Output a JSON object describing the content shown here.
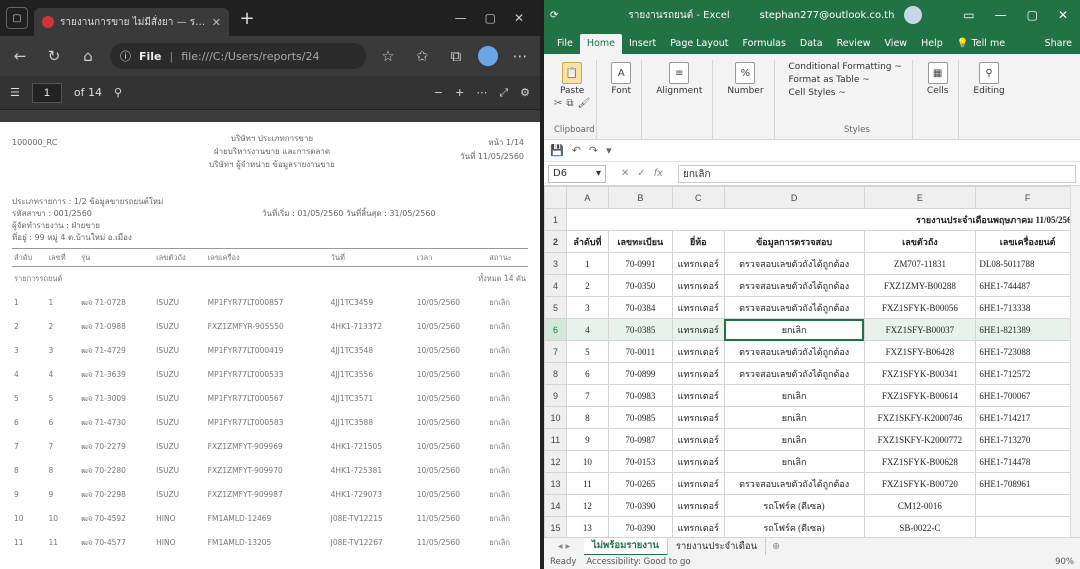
{
  "edge": {
    "tab_title": "รายงานการขาย ไม่มีสั่งยา — รายงาน",
    "url_label": "File",
    "url_text": "file:///C:/Users/reports/24",
    "page_current": "1",
    "page_total": "of 14",
    "zoom_out": "−",
    "zoom_in": "+"
  },
  "pdf": {
    "left_id": "100000_RC",
    "center_lines": [
      "บริษัทฯ ประเภทการขาย",
      "ฝ่ายบริหารงานขาย และการตลาด",
      "บริษัทฯ ผู้จำหน่าย ข้อมูลรายงานขาย"
    ],
    "right_lines": [
      "หน้า 1/14",
      "วันที่ 11/05/2560"
    ],
    "meta": [
      "ประเภทรายการ : 1/2 ข้อมูลขายรถยนต์ใหม่",
      "รหัสสาขา : 001/2560",
      "ผู้จัดทำรายงาน : ฝ่ายขาย",
      "ที่อยู่ : 99 หมู่ 4 ต.บ้านใหม่ อ.เมือง"
    ],
    "meta_right": "วันที่เริ่ม : 01/05/2560   วันที่สิ้นสุด : 31/05/2560",
    "headers": [
      "ลำดับ",
      "เลขที่",
      "รุ่น",
      "เลขตัวถัง",
      "เลขเครื่อง",
      "วันที่",
      "เวลา",
      "สถานะ"
    ],
    "group_label": "รายการรถยนต์",
    "group_right": "ทั้งหมด 14 คัน",
    "rows": [
      [
        "1",
        "1",
        "ฒจ 71-0728",
        "ISUZU",
        "MP1FYR77LT000857",
        "4JJ1TC3459",
        "10/05/2560",
        "ยกเลิก"
      ],
      [
        "2",
        "2",
        "ฒจ 71-0988",
        "ISUZU",
        "FXZ1ZMFYR-905550",
        "4HK1-713372",
        "10/05/2560",
        "ยกเลิก"
      ],
      [
        "3",
        "3",
        "ฒจ 71-4729",
        "ISUZU",
        "MP1FYR77LT000419",
        "4JJ1TC3548",
        "10/05/2560",
        "ยกเลิก"
      ],
      [
        "4",
        "4",
        "ฒจ 71-3639",
        "ISUZU",
        "MP1FYR77LT000533",
        "4JJ1TC3556",
        "10/05/2560",
        "ยกเลิก"
      ],
      [
        "5",
        "5",
        "ฒจ 71-3009",
        "ISUZU",
        "MP1FYR77LT000567",
        "4JJ1TC3571",
        "10/05/2560",
        "ยกเลิก"
      ],
      [
        "6",
        "6",
        "ฒจ 71-4730",
        "ISUZU",
        "MP1FYR77LT000583",
        "4JJ1TC3588",
        "10/05/2560",
        "ยกเลิก"
      ],
      [
        "7",
        "7",
        "ฒจ 70-2279",
        "ISUZU",
        "FXZ1ZMFYT-909969",
        "4HK1-721505",
        "10/05/2560",
        "ยกเลิก"
      ],
      [
        "8",
        "8",
        "ฒจ 70-2280",
        "ISUZU",
        "FXZ1ZMFYT-909970",
        "4HK1-725381",
        "10/05/2560",
        "ยกเลิก"
      ],
      [
        "9",
        "9",
        "ฒจ 70-2298",
        "ISUZU",
        "FXZ1ZMFYT-909987",
        "4HK1-729073",
        "10/05/2560",
        "ยกเลิก"
      ],
      [
        "10",
        "10",
        "ฒจ 70-4592",
        "HINO",
        "FM1AMLD-12469",
        "J08E-TV12215",
        "11/05/2560",
        "ยกเลิก"
      ],
      [
        "11",
        "11",
        "ฒจ 70-4577",
        "HINO",
        "FM1AMLD-13205",
        "J08E-TV12267",
        "11/05/2560",
        "ยกเลิก"
      ]
    ]
  },
  "excel": {
    "window_title": "รายงานรถยนต์ - Excel",
    "account": "stephan277@outlook.co.th",
    "ribbon_tabs": [
      "File",
      "Home",
      "Insert",
      "Page Layout",
      "Formulas",
      "Data",
      "Review",
      "View",
      "Help",
      "Tell me",
      "Share"
    ],
    "ribbon": {
      "paste": "Paste",
      "font": "Font",
      "alignment": "Alignment",
      "number": "Number",
      "cond_format": "Conditional Formatting ~",
      "format_table": "Format as Table ~",
      "cell_styles": "Cell Styles ~",
      "cells": "Cells",
      "editing": "Editing",
      "clipboard_label": "Clipboard",
      "styles_label": "Styles"
    },
    "name_box": "D6",
    "formula": "ยกเลิก",
    "columns": [
      "A",
      "B",
      "C",
      "D",
      "E",
      "F"
    ],
    "title_row": "รายงานประจำเดือนพฤษภาคม 11/05/2560",
    "header_row": [
      "ลำดับที่",
      "เลขทะเบียน",
      "ยี่ห้อ",
      "ข้อมูลการตรวจสอบ",
      "เลขตัวถัง",
      "เลขเครื่องยนต์"
    ],
    "rows": [
      [
        "1",
        "70-0991",
        "แทรกเตอร์",
        "ตรวจสอบเลขตัวถังได้ถูกต้อง",
        "ZM707-11831",
        "DL08-5011788"
      ],
      [
        "2",
        "70-0350",
        "แทรกเตอร์",
        "ตรวจสอบเลขตัวถังได้ถูกต้อง",
        "FXZ1ZMY-B00288",
        "6HE1-744487"
      ],
      [
        "3",
        "70-0384",
        "แทรกเตอร์",
        "ตรวจสอบเลขตัวถังได้ถูกต้อง",
        "FXZ1SFYK-B00056",
        "6HE1-713338"
      ],
      [
        "4",
        "70-0385",
        "แทรกเตอร์",
        "ยกเลิก",
        "FXZ1SFY-B00037",
        "6HE1-821389"
      ],
      [
        "5",
        "70-0011",
        "แทรกเตอร์",
        "ตรวจสอบเลขตัวถังได้ถูกต้อง",
        "FXZ1SFY-B06428",
        "6HE1-723088"
      ],
      [
        "6",
        "70-0899",
        "แทรกเตอร์",
        "ตรวจสอบเลขตัวถังได้ถูกต้อง",
        "FXZ1SFYK-B00341",
        "6HE1-712572"
      ],
      [
        "7",
        "70-0983",
        "แทรกเตอร์",
        "ยกเลิก",
        "FXZ1SFYK-B00614",
        "6HE1-700067"
      ],
      [
        "8",
        "70-0985",
        "แทรกเตอร์",
        "ยกเลิก",
        "FXZ1SKFY-K2000746",
        "6HE1-714217"
      ],
      [
        "9",
        "70-0987",
        "แทรกเตอร์",
        "ยกเลิก",
        "FXZ1SKFY-K2000772",
        "6HE1-713270"
      ],
      [
        "10",
        "70-0153",
        "แทรกเตอร์",
        "ยกเลิก",
        "FXZ1SFYK-B00628",
        "6HE1-714478"
      ],
      [
        "11",
        "70-0265",
        "แทรกเตอร์",
        "ตรวจสอบเลขตัวถังได้ถูกต้อง",
        "FXZ1SFYK-B00720",
        "6HE1-708961"
      ],
      [
        "12",
        "70-0390",
        "แทรกเตอร์",
        "รถโฟร์ค (ดีเซล)",
        "CM12-0016",
        ""
      ],
      [
        "13",
        "70-0390",
        "แทรกเตอร์",
        "รถโฟร์ค (ดีเซล)",
        "SB-0022-C",
        ""
      ]
    ],
    "sheets": [
      "ไม่พร้อมรายงาน",
      "รายงานประจำเดือน"
    ],
    "status_ready": "Ready",
    "status_access": "Accessibility: Good to go",
    "zoom": "90%"
  }
}
